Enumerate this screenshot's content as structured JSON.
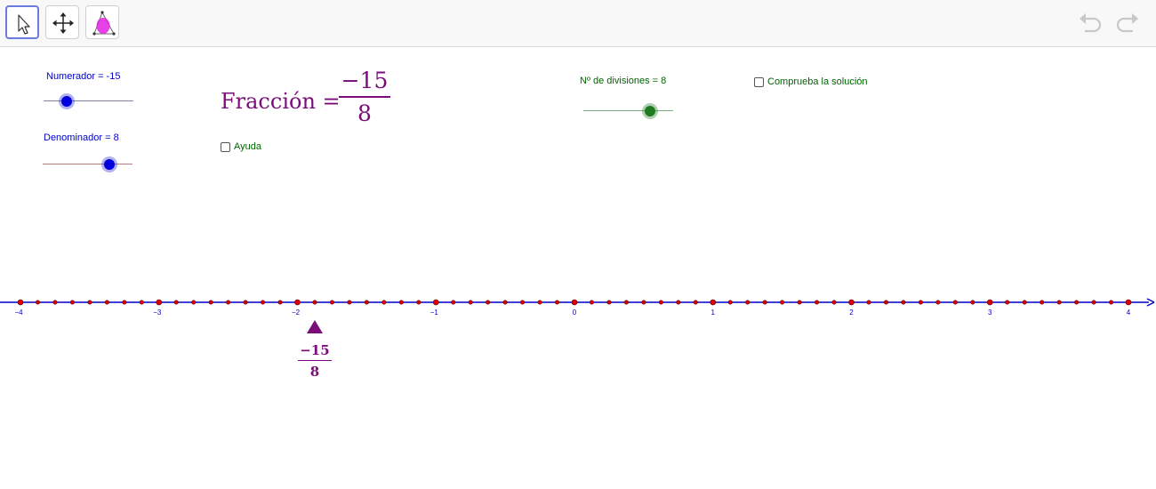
{
  "sliders": {
    "numerator": {
      "label": "Numerador = -15",
      "value": -15,
      "min": -20,
      "max": 20,
      "color": "#0000cc"
    },
    "denominator": {
      "label": "Denominador = 8",
      "value": 8,
      "min": 1,
      "max": 10,
      "color": "#0000cc"
    },
    "divisions": {
      "label": "Nº de divisiones = 8",
      "value": 8,
      "min": 1,
      "max": 10,
      "color": "#006400"
    }
  },
  "fraction": {
    "title": "Fracción =",
    "numerator": "−15",
    "denominator": "8",
    "color": "#7b0d7b"
  },
  "checkboxes": {
    "help": {
      "label": "Ayuda",
      "checked": false
    },
    "check_solution": {
      "label": "Comprueba la solución",
      "checked": false
    }
  },
  "numberline": {
    "min": -4,
    "max": 4,
    "divisions": 8,
    "ticks": [
      "−4",
      "−3",
      "−2",
      "−1",
      "0",
      "1",
      "2",
      "3",
      "4"
    ],
    "marker_value": -1.875,
    "marker_numerator": "−15",
    "marker_denominator": "8",
    "axis_color": "#0000cc",
    "point_color": "#e00000"
  },
  "toolbar": {
    "tools": [
      "pointer-tool",
      "move-graphics-tool",
      "polygon-tool"
    ],
    "selected": "pointer-tool"
  }
}
